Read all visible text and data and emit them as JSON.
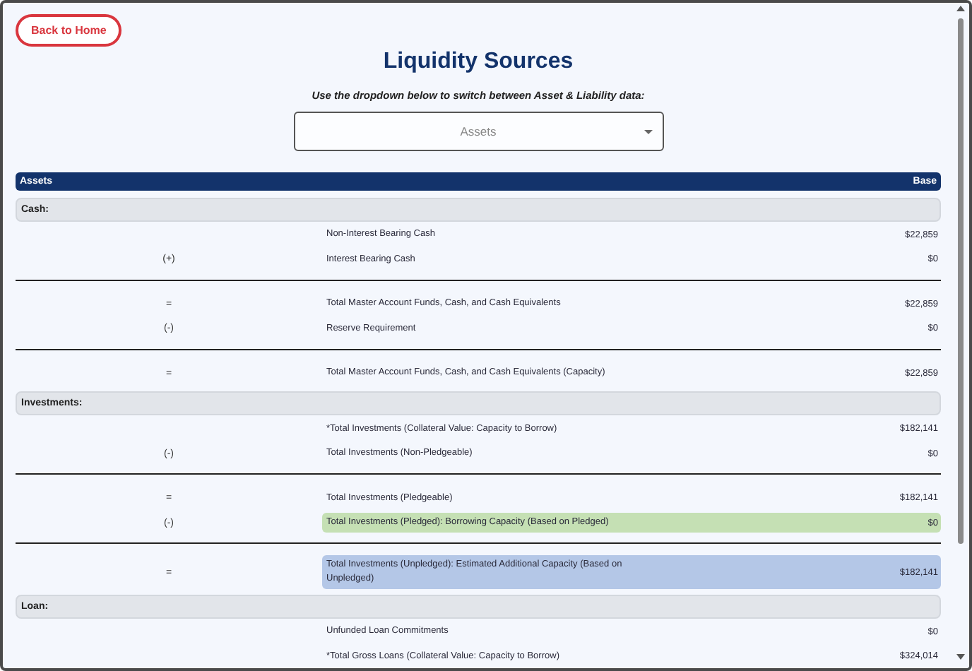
{
  "back_button": {
    "label": "Back to Home"
  },
  "title": "Liquidity Sources",
  "instruction": "Use the dropdown below to switch between Asset & Liability data:",
  "dropdown": {
    "value": "Assets"
  },
  "table": {
    "columns": [
      "Assets",
      "Base"
    ],
    "rows": [
      {
        "kind": "section",
        "label": "Cash:"
      },
      {
        "kind": "item",
        "operator": "",
        "label": "Non-Interest Bearing Cash",
        "value": "$22,859"
      },
      {
        "kind": "item",
        "operator": "(+)",
        "label": "Interest Bearing Cash",
        "value": "$0"
      },
      {
        "kind": "rule"
      },
      {
        "kind": "item",
        "operator": "=",
        "label": "Total Master Account Funds, Cash, and Cash Equivalents",
        "value": "$22,859"
      },
      {
        "kind": "item",
        "operator": "(-)",
        "label": "Reserve Requirement",
        "value": "$0"
      },
      {
        "kind": "rule"
      },
      {
        "kind": "item",
        "operator": "=",
        "label": "Total Master Account Funds, Cash, and Cash Equivalents (Capacity)",
        "value": "$22,859"
      },
      {
        "kind": "section",
        "label": "Investments:"
      },
      {
        "kind": "item",
        "operator": "",
        "label": "*Total Investments (Collateral Value: Capacity to Borrow)",
        "value": "$182,141"
      },
      {
        "kind": "item",
        "operator": "(-)",
        "label": "Total Investments (Non-Pledgeable)",
        "value": "$0"
      },
      {
        "kind": "rule"
      },
      {
        "kind": "item",
        "operator": "=",
        "label": "Total Investments (Pledgeable)",
        "value": "$182,141"
      },
      {
        "kind": "item",
        "operator": "(-)",
        "label": "Total Investments (Pledged): Borrowing Capacity (Based on Pledged)",
        "value": "$0",
        "color": "#c5e0b4"
      },
      {
        "kind": "rule"
      },
      {
        "kind": "item",
        "operator": "=",
        "label": "Total Investments (Unpledged): Estimated Additional Capacity (Based on Unpledged)",
        "value": "$182,141",
        "color": "#b4c7e7"
      },
      {
        "kind": "section",
        "label": "Loan:"
      },
      {
        "kind": "item",
        "operator": "",
        "label": "Unfunded Loan Commitments",
        "value": "$0"
      },
      {
        "kind": "item",
        "operator": "",
        "label": "*Total Gross Loans (Collateral Value: Capacity to Borrow)",
        "value": "$324,014"
      }
    ]
  }
}
